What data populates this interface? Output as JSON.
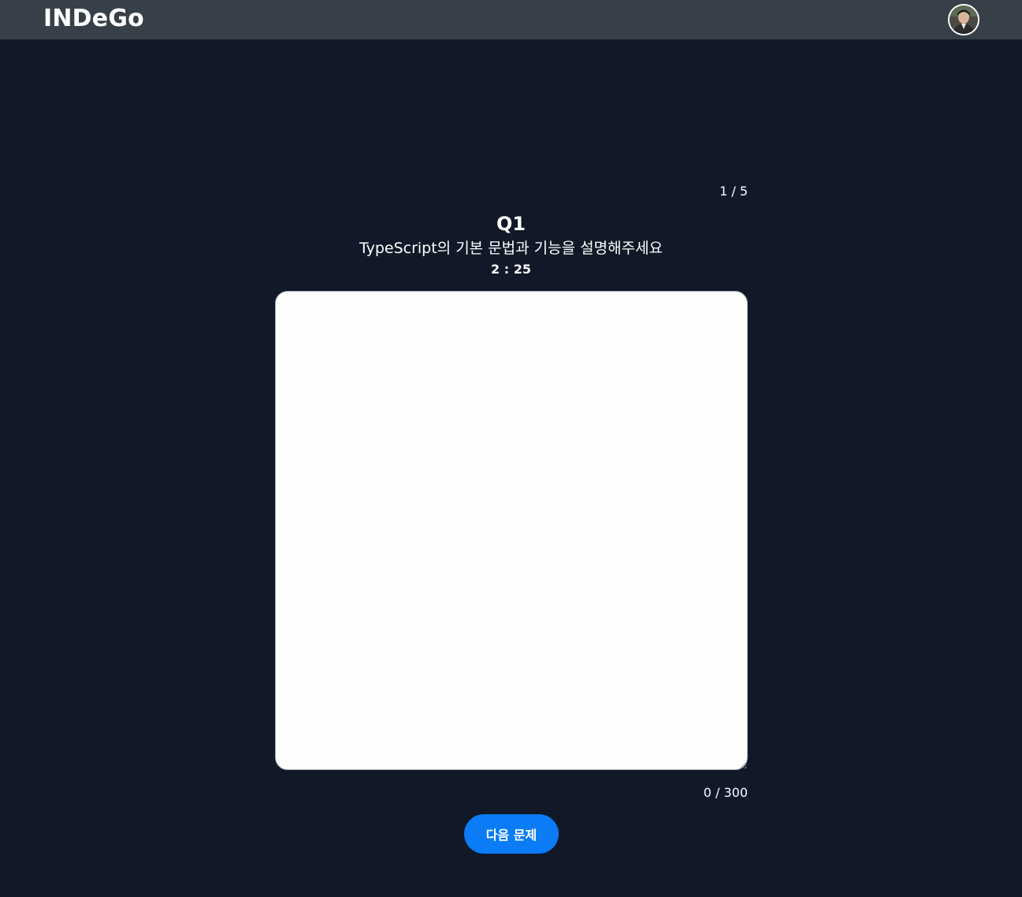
{
  "header": {
    "logo": "INDeGo",
    "avatar_icon": "user-avatar-icon"
  },
  "quiz": {
    "progress": "1 / 5",
    "question_number": "Q1",
    "question_text": "TypeScript의 기본 문법과 기능을 설명해주세요",
    "timer": "2 : 25",
    "answer_value": "",
    "char_count": "0 / 300",
    "next_button_label": "다음 문제"
  },
  "colors": {
    "background": "#111827",
    "header": "#374049",
    "accent": "#0b7cf6",
    "textarea": "#fefefd"
  }
}
